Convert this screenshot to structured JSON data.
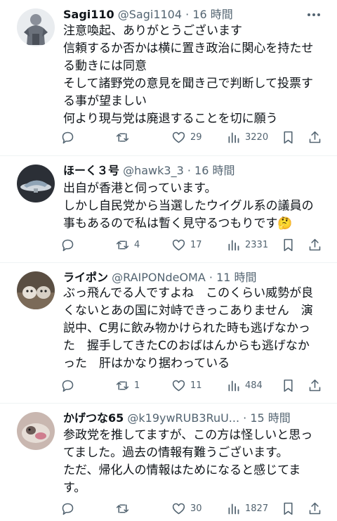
{
  "posts": [
    {
      "name": "Sagi110",
      "handle": "@Sagi1104",
      "dot": "·",
      "time": "16 時間",
      "lines": [
        "注意喚起、ありがとうございます",
        "信頼するか否かは横に置き政治に関心を持たせ",
        "る動きには同意",
        "そして諸野党の意見を聞き己で判断して投票す",
        "る事が望ましい",
        "何より現与党は廃退することを切に願う"
      ],
      "replies": "",
      "reposts": "",
      "likes": "29",
      "views": "3220"
    },
    {
      "name": "ほーく３号",
      "handle": "@hawk3_3",
      "dot": "·",
      "time": "16 時間",
      "lines": [
        "出自が香港と伺っています。",
        "しかし自民党から当選したウイグル系の議員の",
        "事もあるので私は暫く見守るつもりです🤔"
      ],
      "replies": "",
      "reposts": "4",
      "likes": "17",
      "views": "2331"
    },
    {
      "name": "ライポン",
      "handle": "@RAIPONdeOMA",
      "dot": "·",
      "time": "11 時間",
      "lines": [
        "ぶっ飛んでる人ですよね　このくらい威勢が良",
        "くないとあの国に対峙できっこありません　演",
        "説中、C男に飲み物かけられた時も逃げなかっ",
        "た　握手してきたCのおばはんからも逃げなか",
        "った　肝はかなり据わっている"
      ],
      "replies": "",
      "reposts": "1",
      "likes": "11",
      "views": "484"
    },
    {
      "name": "かげつな65",
      "handle": "@k19ywRUB3RuU...",
      "dot": "·",
      "time": "15 時間",
      "lines": [
        "参政党を推してますが、この方は怪しいと思っ",
        "てました。過去の情報有難うございます。",
        "ただ、帰化人の情報はためになると感じてま",
        "す。"
      ],
      "replies": "",
      "reposts": "",
      "likes": "30",
      "views": "1827"
    }
  ],
  "icons": {
    "more": "more-options-icon",
    "reply": "reply-icon",
    "repost": "repost-icon",
    "like": "like-icon",
    "views": "views-icon",
    "bookmark": "bookmark-icon",
    "share": "share-icon"
  },
  "colors": {
    "text": "#0f1419",
    "secondary": "#536471",
    "divider": "#eff3f4"
  }
}
